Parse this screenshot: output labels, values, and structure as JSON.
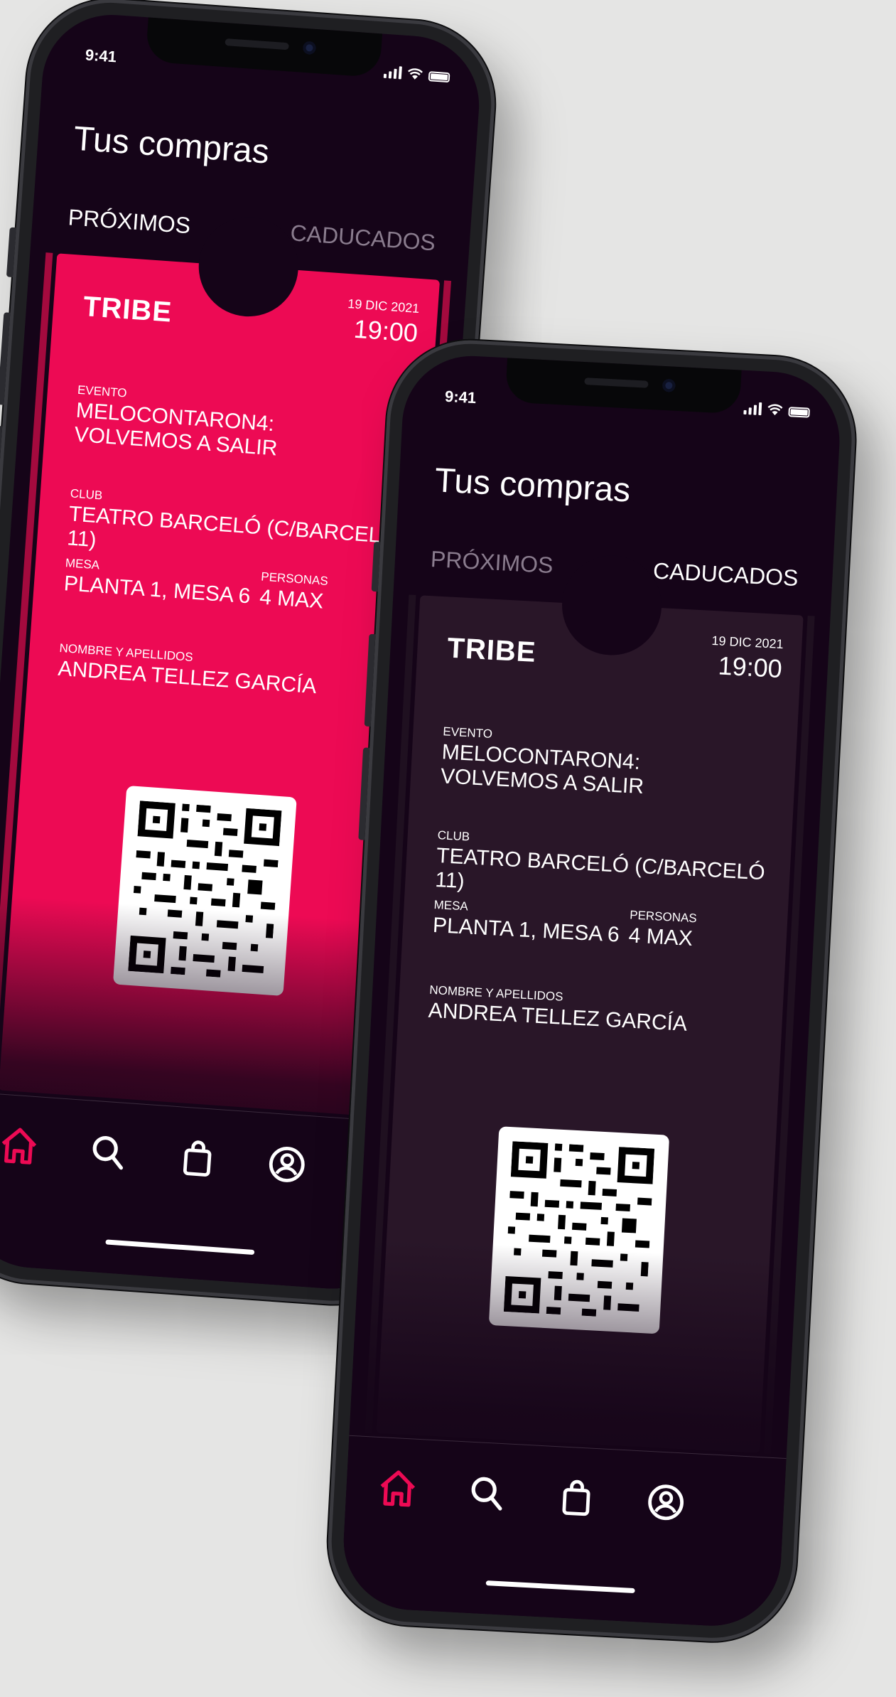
{
  "colors": {
    "background": "#e5e5e4",
    "screen_bg": "#150418",
    "accent_pink": "#ed0a54",
    "ticket_dark": "#291628",
    "tab_dim": "#8a7c8e"
  },
  "phone_back": {
    "status_time": "9:41",
    "title": "Tus compras",
    "tabs": [
      {
        "label": "PRÓXIMOS",
        "active": true
      },
      {
        "label": "CADUCADOS",
        "active": false
      }
    ],
    "ticket": {
      "brand": "TRIBE",
      "date": "19 DIC 2021",
      "time": "19:00",
      "evento_label": "EVENTO",
      "evento_value": "MELOCONTARON4: VOLVEMOS A SALIR",
      "club_label": "CLUB",
      "club_value": "TEATRO BARCELÓ (C/BARCELÓ 11)",
      "mesa_label": "MESA",
      "mesa_value": "PLANTA 1, MESA 6",
      "personas_label": "PERSONAS",
      "personas_value": "4 MAX",
      "nombre_label": "NOMBRE Y APELLIDOS",
      "nombre_value": "ANDREA TELLEZ GARCÍA"
    },
    "nav": [
      "home-icon",
      "search-icon",
      "bag-icon",
      "profile-icon"
    ]
  },
  "phone_front": {
    "status_time": "9:41",
    "title": "Tus compras",
    "tabs": [
      {
        "label": "PRÓXIMOS",
        "active": false
      },
      {
        "label": "CADUCADOS",
        "active": true
      }
    ],
    "ticket": {
      "brand": "TRIBE",
      "date": "19 DIC 2021",
      "time": "19:00",
      "evento_label": "EVENTO",
      "evento_value": "MELOCONTARON4: VOLVEMOS A SALIR",
      "club_label": "CLUB",
      "club_value": "TEATRO BARCELÓ (C/BARCELÓ 11)",
      "mesa_label": "MESA",
      "mesa_value": "PLANTA 1, MESA 6",
      "personas_label": "PERSONAS",
      "personas_value": "4 MAX",
      "nombre_label": "NOMBRE Y APELLIDOS",
      "nombre_value": "ANDREA TELLEZ GARCÍA"
    },
    "nav": [
      "home-icon",
      "search-icon",
      "bag-icon",
      "profile-icon"
    ]
  }
}
